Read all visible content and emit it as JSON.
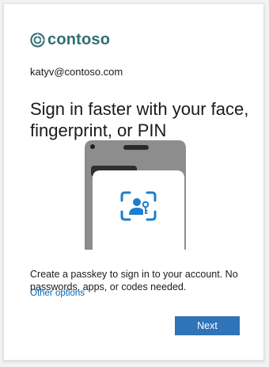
{
  "brand": {
    "name": "contoso",
    "logo_icon": "contoso-logo-icon",
    "color": "#2f6f73"
  },
  "account": {
    "email": "katyv@contoso.com"
  },
  "heading": "Sign in faster with your face, fingerprint, or PIN",
  "illustration": {
    "icon": "face-id-scan-icon",
    "accent": "#1b7fd1"
  },
  "description": "Create a passkey to sign in to your account. No passwords, apps, or codes needed.",
  "links": {
    "other_options": "Other options"
  },
  "buttons": {
    "next": "Next",
    "next_color": "#2f73b8"
  }
}
